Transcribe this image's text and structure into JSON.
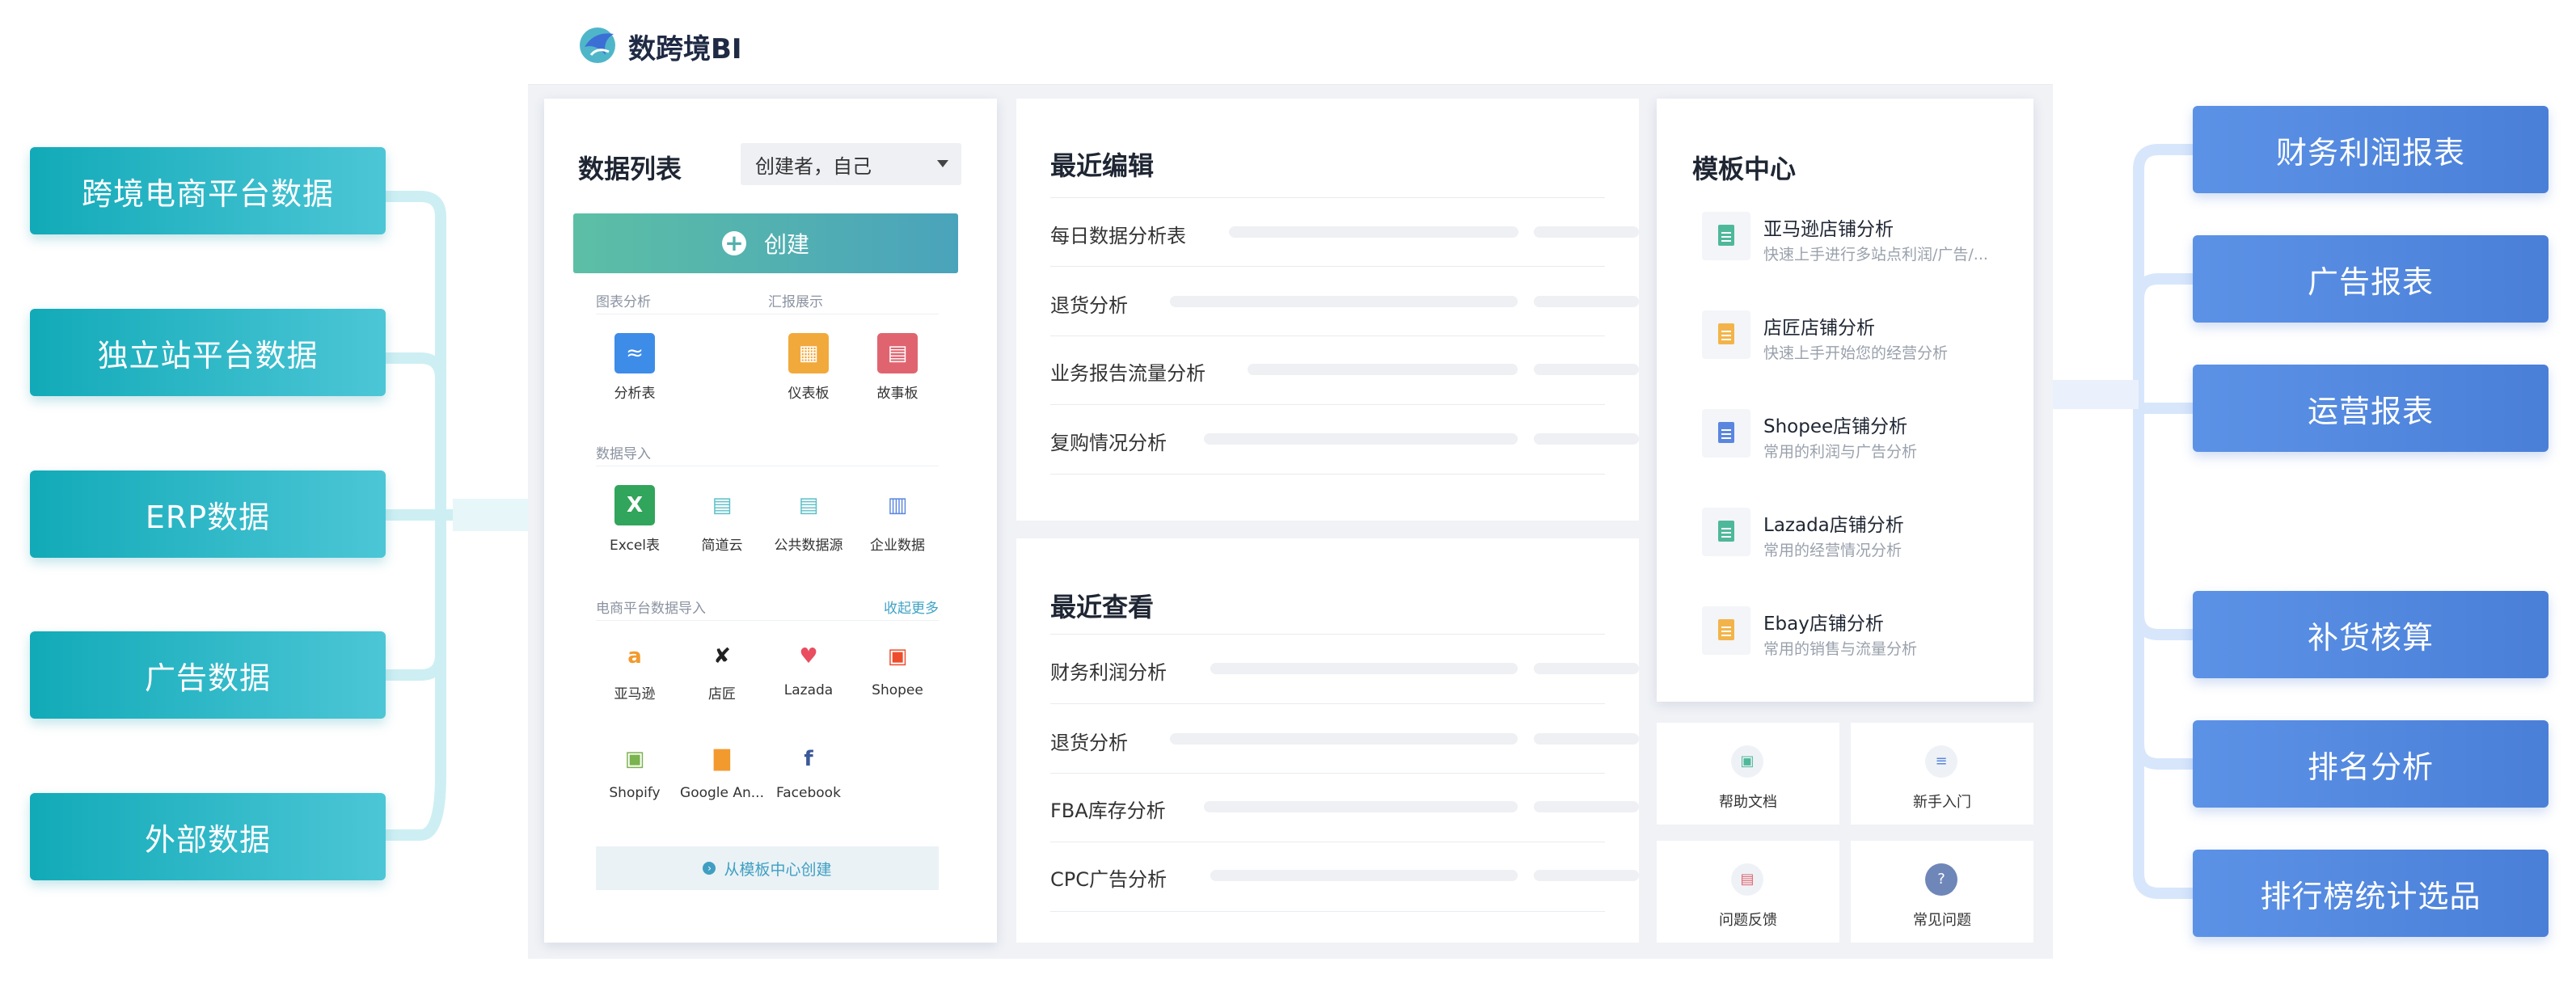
{
  "sources": [
    "跨境电商平台数据",
    "独立站平台数据",
    "ERP数据",
    "广告数据",
    "外部数据"
  ],
  "outputs": [
    "财务利润报表",
    "广告报表",
    "运营报表",
    "补货核算",
    "排名分析",
    "排行榜统计选品"
  ],
  "app": {
    "name": "数跨境BI"
  },
  "data_list": {
    "title": "数据列表",
    "creator_filter": "创建者，自己",
    "create_label": "创建",
    "chart_section": "图表分析",
    "report_section": "汇报展示",
    "chart_items": [
      {
        "label": "分析表",
        "icon": "chart-icon"
      }
    ],
    "report_items": [
      {
        "label": "仪表板",
        "icon": "dashboard-icon"
      },
      {
        "label": "故事板",
        "icon": "storyboard-icon"
      }
    ],
    "import_section": "数据导入",
    "import_items": [
      {
        "label": "Excel表",
        "icon": "excel-icon"
      },
      {
        "label": "简道云",
        "icon": "jiandaoyun-icon"
      },
      {
        "label": "公共数据源",
        "icon": "public-datasource-icon"
      },
      {
        "label": "企业数据",
        "icon": "enterprise-data-icon"
      }
    ],
    "ecommerce_section": "电商平台数据导入",
    "more_link": "收起更多",
    "platforms": [
      {
        "label": "亚马逊",
        "icon": "amazon-icon"
      },
      {
        "label": "店匠",
        "icon": "shoplazza-icon"
      },
      {
        "label": "Lazada",
        "icon": "lazada-icon"
      },
      {
        "label": "Shopee",
        "icon": "shopee-icon"
      },
      {
        "label": "Shopify",
        "icon": "shopify-icon"
      },
      {
        "label": "Google An...",
        "icon": "google-analytics-icon"
      },
      {
        "label": "Facebook",
        "icon": "facebook-icon"
      }
    ],
    "template_create": "从模板中心创建"
  },
  "recent_edit": {
    "title": "最近编辑",
    "items": [
      "每日数据分析表",
      "退货分析",
      "业务报告流量分析",
      "复购情况分析"
    ]
  },
  "recent_view": {
    "title": "最近查看",
    "items": [
      "财务利润分析",
      "退货分析",
      "FBA库存分析",
      "CPC广告分析"
    ]
  },
  "template_center": {
    "title": "模板中心",
    "items": [
      {
        "name": "亚马逊店铺分析",
        "desc": "快速上手进行多站点利润/广告/...",
        "color": "#4fb89a"
      },
      {
        "name": "店匠店铺分析",
        "desc": "快速上手开始您的经营分析",
        "color": "#f2b44a"
      },
      {
        "name": "Shopee店铺分析",
        "desc": "常用的利润与广告分析",
        "color": "#5b86e0"
      },
      {
        "name": "Lazada店铺分析",
        "desc": "常用的经营情况分析",
        "color": "#4fb89a"
      },
      {
        "name": "Ebay店铺分析",
        "desc": "常用的销售与流量分析",
        "color": "#f2b44a"
      }
    ]
  },
  "help": {
    "docs": "帮助文档",
    "beginner": "新手入门",
    "feedback": "问题反馈",
    "faq": "常见问题"
  },
  "colors": {
    "source_pill": "#12aab8",
    "output_pill": "#4a7fd8",
    "accent": "#3fa3c5"
  }
}
